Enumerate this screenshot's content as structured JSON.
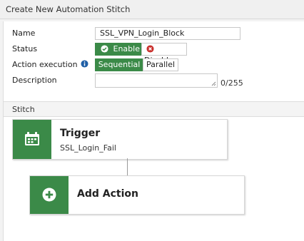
{
  "dialog": {
    "title": "Create New Automation Stitch"
  },
  "form": {
    "name_label": "Name",
    "name_value": "SSL_VPN_Login_Block",
    "status_label": "Status",
    "status_options": [
      {
        "label": "Enable",
        "selected": true,
        "icon": "check-circle-icon"
      },
      {
        "label": "Disable",
        "selected": false,
        "icon": "x-circle-icon"
      }
    ],
    "exec_label": "Action execution",
    "exec_options": [
      {
        "label": "Sequential",
        "selected": true
      },
      {
        "label": "Parallel",
        "selected": false
      }
    ],
    "description_label": "Description",
    "description_value": "",
    "description_counter": "0/255"
  },
  "stitch": {
    "section_title": "Stitch",
    "trigger": {
      "title": "Trigger",
      "subtitle": "SSL_Login_Fail",
      "icon": "calendar-icon"
    },
    "add_action": {
      "label": "Add Action",
      "icon": "plus-circle-icon"
    }
  },
  "colors": {
    "accent_green": "#3b8a48",
    "info_blue": "#1f5fa6",
    "danger_red": "#c9302c"
  }
}
